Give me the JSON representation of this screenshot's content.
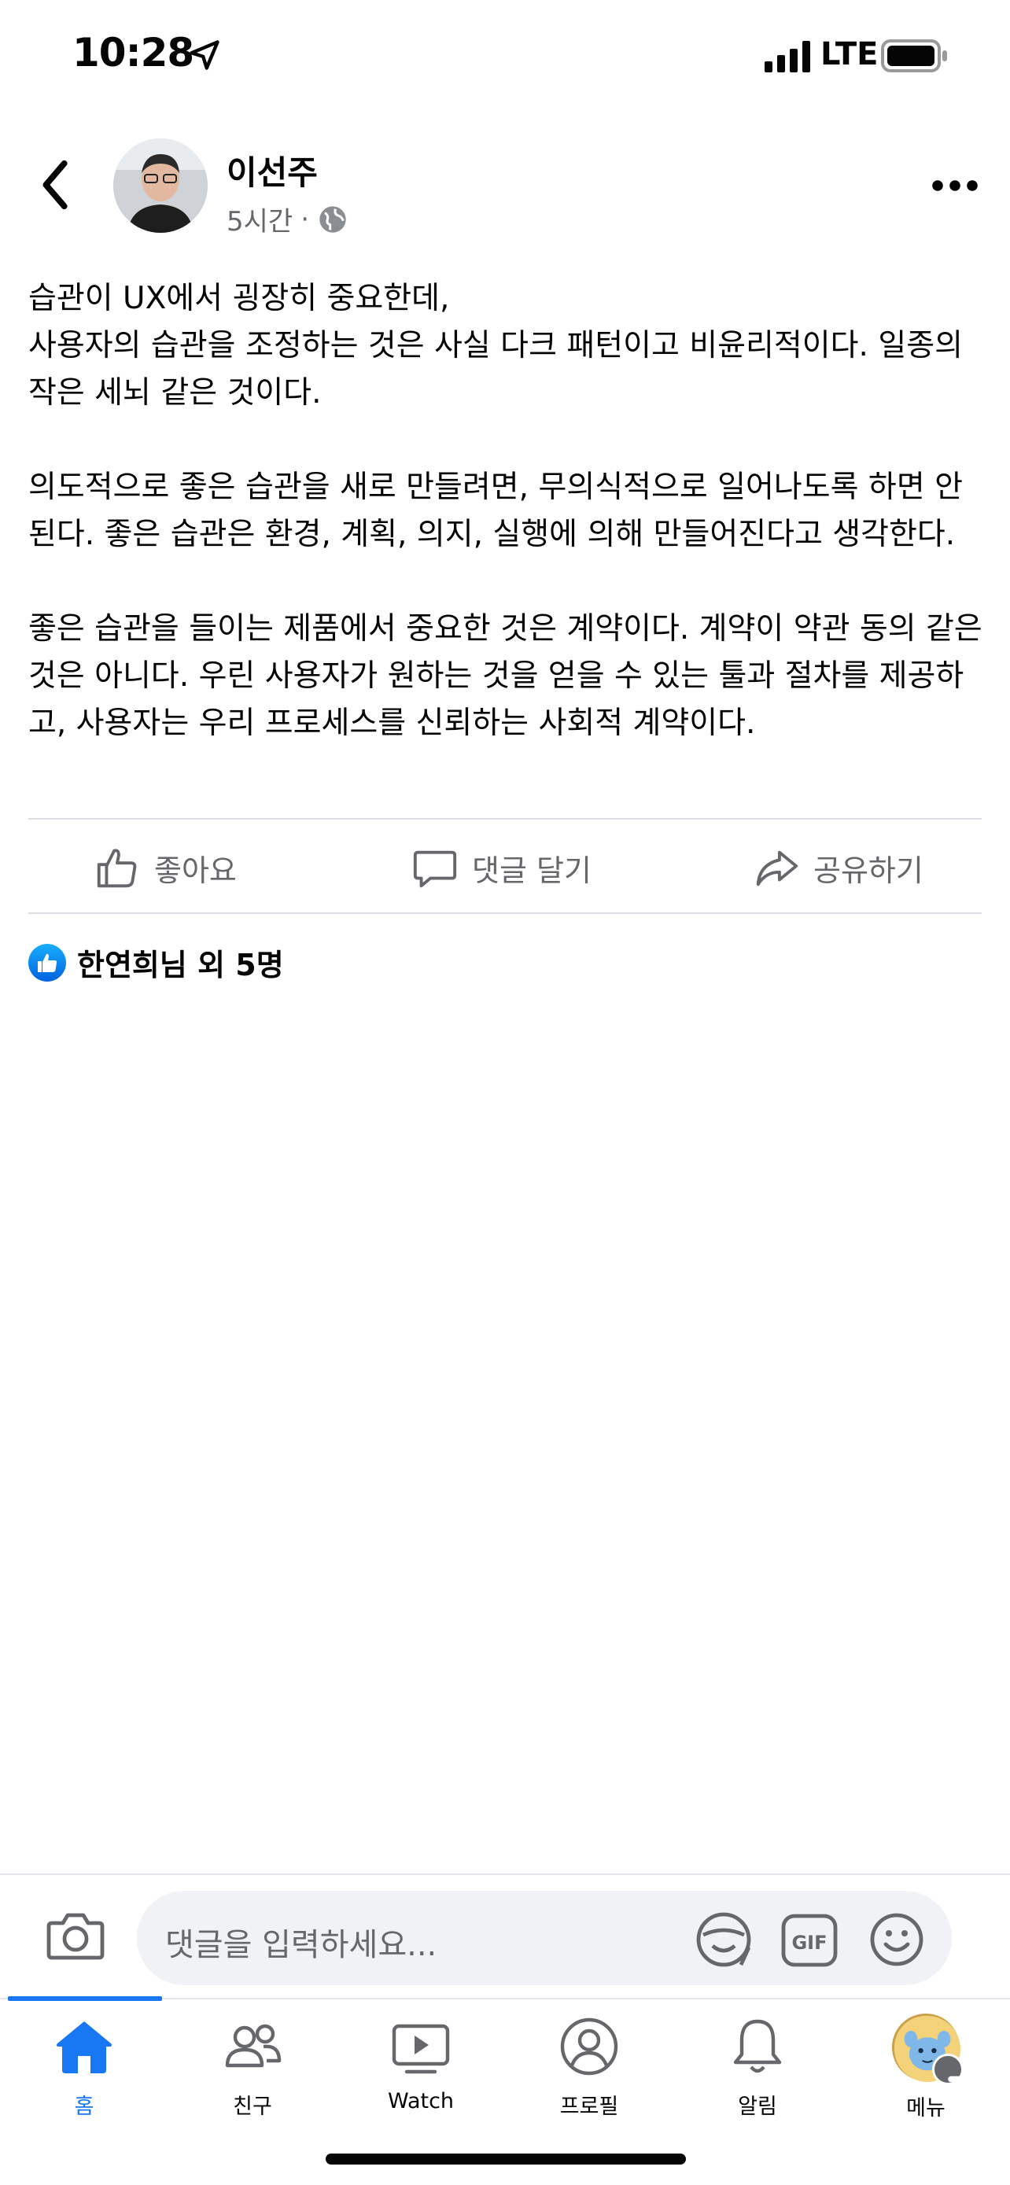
{
  "status_bar": {
    "time": "10:28",
    "network": "LTE"
  },
  "post": {
    "author": "이선주",
    "time_ago": "5시간",
    "meta_separator": "·",
    "paragraphs": [
      [
        "습관이 UX에서 굉장히 중요한데,",
        "사용자의 습관을 조정하는 것은 사실 다크 패턴이고 비윤리적이다. 일종의 작은 세뇌 같은 것이다."
      ],
      [
        "의도적으로 좋은 습관을 새로 만들려면, 무의식적으로 일어나도록 하면 안된다. 좋은 습관은 환경, 계획, 의지, 실행에 의해 만들어진다고 생각한다."
      ],
      [
        "좋은 습관을 들이는 제품에서 중요한 것은 계약이다. 계약이 약관 동의 같은 것은 아니다. 우린 사용자가 원하는 것을 얻을 수 있는 툴과 절차를 제공하고, 사용자는 우리 프로세스를 신뢰하는 사회적 계약이다."
      ]
    ]
  },
  "actions": {
    "like": "좋아요",
    "comment": "댓글 달기",
    "share": "공유하기"
  },
  "reactions": {
    "text": "한연희님 외 5명"
  },
  "composer": {
    "placeholder": "댓글을 입력하세요..."
  },
  "tabs": [
    {
      "label": "홈",
      "icon": "home-icon",
      "active": true
    },
    {
      "label": "친구",
      "icon": "friends-icon",
      "active": false
    },
    {
      "label": "Watch",
      "icon": "watch-icon",
      "active": false
    },
    {
      "label": "프로필",
      "icon": "profile-icon",
      "active": false
    },
    {
      "label": "알림",
      "icon": "bell-icon",
      "active": false
    },
    {
      "label": "메뉴",
      "icon": "menu-avatar",
      "active": false
    }
  ],
  "colors": {
    "accent": "#1877f2",
    "secondary_text": "#65676b",
    "field_bg": "#f0f2f5"
  }
}
